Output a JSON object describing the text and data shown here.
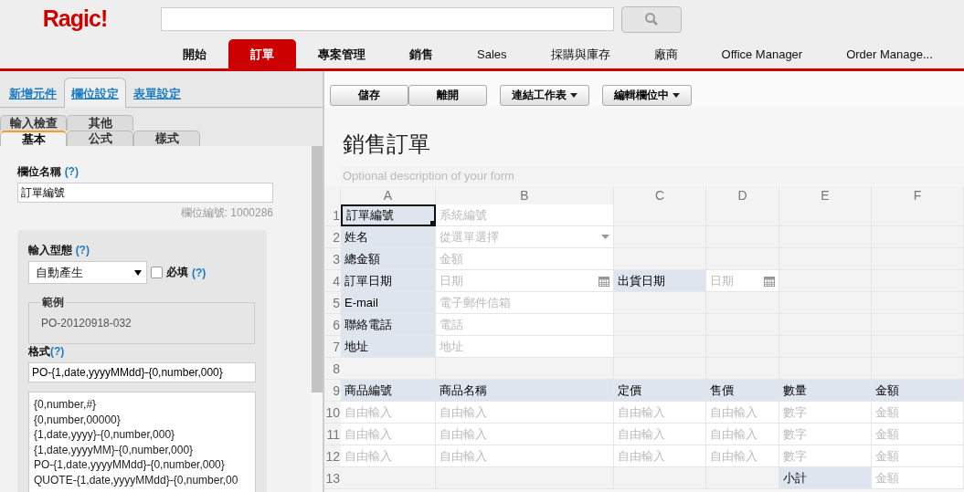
{
  "header": {
    "logo": "Ragic!",
    "nav_tabs": [
      {
        "label": "開始",
        "selected": false
      },
      {
        "label": "訂單",
        "selected": true
      },
      {
        "label": "專案管理",
        "selected": false
      },
      {
        "label": "銷售",
        "selected": false
      },
      {
        "label": "Sales",
        "selected": false
      },
      {
        "label": "採購與庫存",
        "selected": false
      },
      {
        "label": "廠商",
        "selected": false
      },
      {
        "label": "Office Manager",
        "selected": false
      },
      {
        "label": "Order Manage...",
        "selected": false
      }
    ]
  },
  "left_panel": {
    "tabs": [
      {
        "label": "新增元件",
        "selected": false
      },
      {
        "label": "欄位設定",
        "selected": true
      },
      {
        "label": "表單設定",
        "selected": false
      }
    ],
    "sub_tab_rows": [
      {
        "tabs": [
          {
            "label": "輸入檢查",
            "selected": false
          },
          {
            "label": "其他",
            "selected": false
          }
        ]
      },
      {
        "tabs": [
          {
            "label": "基本",
            "selected": true
          },
          {
            "label": "公式",
            "selected": false
          },
          {
            "label": "樣式",
            "selected": false
          }
        ]
      }
    ],
    "field_name": {
      "label": "欄位名稱",
      "help": "(?)",
      "value": "訂單編號",
      "field_id": "欄位編號: 1000286"
    },
    "input_type": {
      "label": "輸入型態",
      "help": "(?)",
      "value": "自動產生",
      "required": {
        "label": "必填",
        "checked": false,
        "help": "(?)"
      }
    },
    "example": {
      "legend": "範例",
      "value": "PO-20120918-032"
    },
    "format": {
      "label": "格式",
      "help": "(?)",
      "value": "PO-{1,date,yyyyMMdd}-{0,number,000}",
      "presets": [
        "{0,number,#}",
        "{0,number,00000}",
        "{1,date,yyyy}-{0,number,000}",
        "{1,date,yyyyMM}-{0,number,000}",
        "PO-{1,date,yyyyMMdd}-{0,number,000}",
        "QUOTE-{1,date,yyyyMMdd}-{0,number,00"
      ]
    }
  },
  "toolbar": {
    "groups": [
      {
        "buttons": [
          {
            "label": "儲存",
            "dropdown": false
          },
          {
            "label": "離開",
            "dropdown": false
          }
        ]
      },
      {
        "buttons": [
          {
            "label": "連結工作表",
            "dropdown": true
          }
        ]
      },
      {
        "buttons": [
          {
            "label": "編輯欄位中",
            "dropdown": true
          }
        ]
      }
    ]
  },
  "form": {
    "title": "銷售訂單",
    "description_placeholder": "Optional description of your form",
    "columns": [
      "A",
      "B",
      "C",
      "D",
      "E",
      "F"
    ],
    "rows": [
      {
        "number": "1",
        "cells": [
          {
            "kind": "label",
            "text": "訂單編號",
            "selected": true
          },
          {
            "kind": "field",
            "text": "系統編號",
            "selected": false
          },
          {
            "kind": "empty",
            "selected": false
          },
          {
            "kind": "empty",
            "selected": false
          },
          {
            "kind": "empty",
            "selected": false
          },
          {
            "kind": "empty",
            "selected": false
          }
        ]
      },
      {
        "number": "2",
        "cells": [
          {
            "kind": "label",
            "text": "姓名",
            "selected": false
          },
          {
            "kind": "select",
            "text": "從選單選擇",
            "selected": false
          },
          {
            "kind": "empty",
            "selected": false
          },
          {
            "kind": "empty",
            "selected": false
          },
          {
            "kind": "empty",
            "selected": false
          },
          {
            "kind": "empty",
            "selected": false
          }
        ]
      },
      {
        "number": "3",
        "cells": [
          {
            "kind": "label",
            "text": "總金額",
            "selected": false
          },
          {
            "kind": "field",
            "text": "金額",
            "selected": false
          },
          {
            "kind": "empty",
            "selected": false
          },
          {
            "kind": "empty",
            "selected": false
          },
          {
            "kind": "empty",
            "selected": false
          },
          {
            "kind": "empty",
            "selected": false
          }
        ]
      },
      {
        "number": "4",
        "cells": [
          {
            "kind": "label",
            "text": "訂單日期",
            "selected": false
          },
          {
            "kind": "date",
            "text": "日期",
            "selected": false
          },
          {
            "kind": "label",
            "text": "出貨日期",
            "selected": false
          },
          {
            "kind": "date",
            "text": "日期",
            "selected": false
          },
          {
            "kind": "empty",
            "selected": false
          },
          {
            "kind": "empty",
            "selected": false
          }
        ]
      },
      {
        "number": "5",
        "cells": [
          {
            "kind": "label",
            "text": "E-mail",
            "selected": false
          },
          {
            "kind": "field",
            "text": "電子郵件信箱",
            "selected": false
          },
          {
            "kind": "empty",
            "selected": false
          },
          {
            "kind": "empty",
            "selected": false
          },
          {
            "kind": "empty",
            "selected": false
          },
          {
            "kind": "empty",
            "selected": false
          }
        ]
      },
      {
        "number": "6",
        "cells": [
          {
            "kind": "label",
            "text": "聯絡電話",
            "selected": false
          },
          {
            "kind": "field",
            "text": "電話",
            "selected": false
          },
          {
            "kind": "empty",
            "selected": false
          },
          {
            "kind": "empty",
            "selected": false
          },
          {
            "kind": "empty",
            "selected": false
          },
          {
            "kind": "empty",
            "selected": false
          }
        ]
      },
      {
        "number": "7",
        "cells": [
          {
            "kind": "label",
            "text": "地址",
            "selected": false
          },
          {
            "kind": "field",
            "text": "地址",
            "selected": false
          },
          {
            "kind": "empty",
            "selected": false
          },
          {
            "kind": "empty",
            "selected": false
          },
          {
            "kind": "empty",
            "selected": false
          },
          {
            "kind": "empty",
            "selected": false
          }
        ]
      },
      {
        "number": "8",
        "cells": [
          {
            "kind": "empty",
            "selected": false
          },
          {
            "kind": "empty",
            "selected": false
          },
          {
            "kind": "empty",
            "selected": false
          },
          {
            "kind": "empty",
            "selected": false
          },
          {
            "kind": "empty",
            "selected": false
          },
          {
            "kind": "empty",
            "selected": false
          }
        ]
      },
      {
        "number": "9",
        "cells": [
          {
            "kind": "label",
            "text": "商品編號",
            "selected": false
          },
          {
            "kind": "label",
            "text": "商品名稱",
            "selected": false
          },
          {
            "kind": "label",
            "text": "定價",
            "selected": false
          },
          {
            "kind": "label",
            "text": "售價",
            "selected": false
          },
          {
            "kind": "label",
            "text": "數量",
            "selected": false
          },
          {
            "kind": "label",
            "text": "金額",
            "selected": false
          }
        ]
      },
      {
        "number": "10",
        "cells": [
          {
            "kind": "field",
            "text": "自由輸入",
            "selected": false
          },
          {
            "kind": "field",
            "text": "自由輸入",
            "selected": false
          },
          {
            "kind": "field",
            "text": "自由輸入",
            "selected": false
          },
          {
            "kind": "field",
            "text": "自由輸入",
            "selected": false
          },
          {
            "kind": "field",
            "text": "數字",
            "selected": false
          },
          {
            "kind": "field",
            "text": "金額",
            "selected": false
          }
        ]
      },
      {
        "number": "11",
        "cells": [
          {
            "kind": "field",
            "text": "自由輸入",
            "selected": false
          },
          {
            "kind": "field",
            "text": "自由輸入",
            "selected": false
          },
          {
            "kind": "field",
            "text": "自由輸入",
            "selected": false
          },
          {
            "kind": "field",
            "text": "自由輸入",
            "selected": false
          },
          {
            "kind": "field",
            "text": "數字",
            "selected": false
          },
          {
            "kind": "field",
            "text": "金額",
            "selected": false
          }
        ]
      },
      {
        "number": "12",
        "cells": [
          {
            "kind": "field",
            "text": "自由輸入",
            "selected": false
          },
          {
            "kind": "field",
            "text": "自由輸入",
            "selected": false
          },
          {
            "kind": "field",
            "text": "自由輸入",
            "selected": false
          },
          {
            "kind": "field",
            "text": "自由輸入",
            "selected": false
          },
          {
            "kind": "field",
            "text": "數字",
            "selected": false
          },
          {
            "kind": "field",
            "text": "金額",
            "selected": false
          }
        ]
      },
      {
        "number": "13",
        "cells": [
          {
            "kind": "empty",
            "selected": false
          },
          {
            "kind": "empty",
            "selected": false
          },
          {
            "kind": "empty",
            "selected": false
          },
          {
            "kind": "empty",
            "selected": false
          },
          {
            "kind": "label",
            "text": "小計",
            "selected": false
          },
          {
            "kind": "field",
            "text": "金額",
            "selected": false
          }
        ]
      }
    ]
  }
}
